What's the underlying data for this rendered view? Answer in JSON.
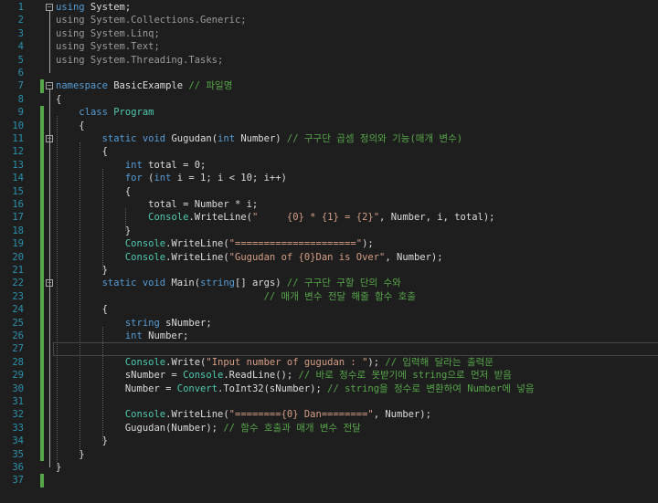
{
  "editor": {
    "lines": [
      {
        "n": "1",
        "fold": "minus",
        "segs": [
          [
            "kw",
            "using"
          ],
          [
            "pl",
            " System;"
          ]
        ]
      },
      {
        "n": "2",
        "segs": [
          [
            "gd",
            "using"
          ],
          [
            "gd",
            " System.Collections.Generic;"
          ]
        ]
      },
      {
        "n": "3",
        "segs": [
          [
            "gd",
            "using"
          ],
          [
            "gd",
            " System.Linq;"
          ]
        ]
      },
      {
        "n": "4",
        "segs": [
          [
            "gd",
            "using"
          ],
          [
            "gd",
            " System.Text;"
          ]
        ]
      },
      {
        "n": "5",
        "segs": [
          [
            "gd",
            "using"
          ],
          [
            "gd",
            " System.Threading.Tasks;"
          ]
        ]
      },
      {
        "n": "6",
        "segs": []
      },
      {
        "n": "7",
        "fold": "minus",
        "changed": true,
        "segs": [
          [
            "kw",
            "namespace"
          ],
          [
            "pl",
            " BasicExample "
          ],
          [
            "cm",
            "// 파일명"
          ]
        ]
      },
      {
        "n": "8",
        "segs": [
          [
            "pl",
            "{"
          ]
        ]
      },
      {
        "n": "9",
        "changed": true,
        "segs": [
          [
            "pl",
            "    "
          ],
          [
            "kw",
            "class"
          ],
          [
            "pl",
            " "
          ],
          [
            "tp",
            "Program"
          ]
        ]
      },
      {
        "n": "10",
        "changed": true,
        "segs": [
          [
            "pl",
            "    {"
          ]
        ]
      },
      {
        "n": "11",
        "fold": "minus",
        "changed": true,
        "segs": [
          [
            "pl",
            "        "
          ],
          [
            "kw",
            "static"
          ],
          [
            "pl",
            " "
          ],
          [
            "kw",
            "void"
          ],
          [
            "pl",
            " Gugudan("
          ],
          [
            "kw",
            "int"
          ],
          [
            "pl",
            " Number) "
          ],
          [
            "cm",
            "// 구구단 곱셈 정의와 기능(매개 변수)"
          ]
        ]
      },
      {
        "n": "12",
        "changed": true,
        "segs": [
          [
            "pl",
            "        {"
          ]
        ]
      },
      {
        "n": "13",
        "changed": true,
        "segs": [
          [
            "pl",
            "            "
          ],
          [
            "kw",
            "int"
          ],
          [
            "pl",
            " total = 0;"
          ]
        ]
      },
      {
        "n": "14",
        "changed": true,
        "segs": [
          [
            "pl",
            "            "
          ],
          [
            "kw",
            "for"
          ],
          [
            "pl",
            " ("
          ],
          [
            "kw",
            "int"
          ],
          [
            "pl",
            " i = 1; i < 10; i++)"
          ]
        ]
      },
      {
        "n": "15",
        "changed": true,
        "segs": [
          [
            "pl",
            "            {"
          ]
        ]
      },
      {
        "n": "16",
        "changed": true,
        "segs": [
          [
            "pl",
            "                total = Number * i;"
          ]
        ]
      },
      {
        "n": "17",
        "changed": true,
        "segs": [
          [
            "pl",
            "                "
          ],
          [
            "tp",
            "Console"
          ],
          [
            "pl",
            ".WriteLine("
          ],
          [
            "str",
            "\"     {0} * {1} = {2}\""
          ],
          [
            "pl",
            ", Number, i, total);"
          ]
        ]
      },
      {
        "n": "18",
        "changed": true,
        "segs": [
          [
            "pl",
            "            }"
          ]
        ]
      },
      {
        "n": "19",
        "changed": true,
        "segs": [
          [
            "pl",
            "            "
          ],
          [
            "tp",
            "Console"
          ],
          [
            "pl",
            ".WriteLine("
          ],
          [
            "str",
            "\"=====================\""
          ],
          [
            "pl",
            ");"
          ]
        ]
      },
      {
        "n": "20",
        "changed": true,
        "segs": [
          [
            "pl",
            "            "
          ],
          [
            "tp",
            "Console"
          ],
          [
            "pl",
            ".WriteLine("
          ],
          [
            "str",
            "\"Gugudan of {0}Dan is Over\""
          ],
          [
            "pl",
            ", Number);"
          ]
        ]
      },
      {
        "n": "21",
        "changed": true,
        "segs": [
          [
            "pl",
            "        }"
          ]
        ]
      },
      {
        "n": "22",
        "fold": "minus",
        "changed": true,
        "segs": [
          [
            "pl",
            "        "
          ],
          [
            "kw",
            "static"
          ],
          [
            "pl",
            " "
          ],
          [
            "kw",
            "void"
          ],
          [
            "pl",
            " Main("
          ],
          [
            "kw",
            "string"
          ],
          [
            "pl",
            "[] args) "
          ],
          [
            "cm",
            "// 구구단 구할 단의 수와"
          ]
        ]
      },
      {
        "n": "23",
        "changed": true,
        "segs": [
          [
            "pl",
            "                                    "
          ],
          [
            "cm",
            "// 매개 변수 전달 해줄 함수 호출"
          ]
        ]
      },
      {
        "n": "24",
        "changed": true,
        "segs": [
          [
            "pl",
            "        {"
          ]
        ]
      },
      {
        "n": "25",
        "changed": true,
        "segs": [
          [
            "pl",
            "            "
          ],
          [
            "kw",
            "string"
          ],
          [
            "pl",
            " sNumber;"
          ]
        ]
      },
      {
        "n": "26",
        "changed": true,
        "segs": [
          [
            "pl",
            "            "
          ],
          [
            "kw",
            "int"
          ],
          [
            "pl",
            " Number;"
          ]
        ]
      },
      {
        "n": "27",
        "changed": true,
        "current": true,
        "segs": []
      },
      {
        "n": "28",
        "changed": true,
        "segs": [
          [
            "pl",
            "            "
          ],
          [
            "tp",
            "Console"
          ],
          [
            "pl",
            ".Write("
          ],
          [
            "str",
            "\"Input number of gugudan : \""
          ],
          [
            "pl",
            "); "
          ],
          [
            "cm",
            "// 입력해 달라는 출력문"
          ]
        ]
      },
      {
        "n": "29",
        "changed": true,
        "segs": [
          [
            "pl",
            "            sNumber = "
          ],
          [
            "tp",
            "Console"
          ],
          [
            "pl",
            ".ReadLine(); "
          ],
          [
            "cm",
            "// 바로 정수로 못받기에 string으로 먼저 받음"
          ]
        ]
      },
      {
        "n": "30",
        "changed": true,
        "segs": [
          [
            "pl",
            "            Number = "
          ],
          [
            "tp",
            "Convert"
          ],
          [
            "pl",
            ".ToInt32(sNumber); "
          ],
          [
            "cm",
            "// string을 정수로 변환하여 Number에 넣음"
          ]
        ]
      },
      {
        "n": "31",
        "changed": true,
        "segs": []
      },
      {
        "n": "32",
        "changed": true,
        "segs": [
          [
            "pl",
            "            "
          ],
          [
            "tp",
            "Console"
          ],
          [
            "pl",
            ".WriteLine("
          ],
          [
            "str",
            "\"========{0} Dan========\""
          ],
          [
            "pl",
            ", Number);"
          ]
        ]
      },
      {
        "n": "33",
        "changed": true,
        "segs": [
          [
            "pl",
            "            Gugudan(Number); "
          ],
          [
            "cm",
            "// 함수 호출과 매개 변수 전달"
          ]
        ]
      },
      {
        "n": "34",
        "changed": true,
        "segs": [
          [
            "pl",
            "        }"
          ]
        ]
      },
      {
        "n": "35",
        "changed": true,
        "segs": [
          [
            "pl",
            "    }"
          ]
        ]
      },
      {
        "n": "36",
        "segs": [
          [
            "pl",
            "}"
          ]
        ]
      },
      {
        "n": "37",
        "changed": true,
        "segs": []
      }
    ]
  }
}
